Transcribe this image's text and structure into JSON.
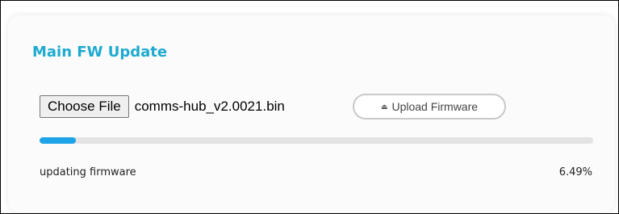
{
  "card": {
    "title": "Main FW Update"
  },
  "file_input": {
    "button_label": "Choose File",
    "file_name": "comms-hub_v2.0021.bin"
  },
  "upload": {
    "icon": "eject-icon",
    "icon_glyph": "⏏",
    "label": "Upload Firmware"
  },
  "progress": {
    "percent": 6.49,
    "percent_text": "6.49%",
    "status": "updating firmware",
    "fill_color": "#1ea3e6",
    "track_color": "#e3e3e3"
  },
  "colors": {
    "title_accent": "#1eaad0"
  }
}
